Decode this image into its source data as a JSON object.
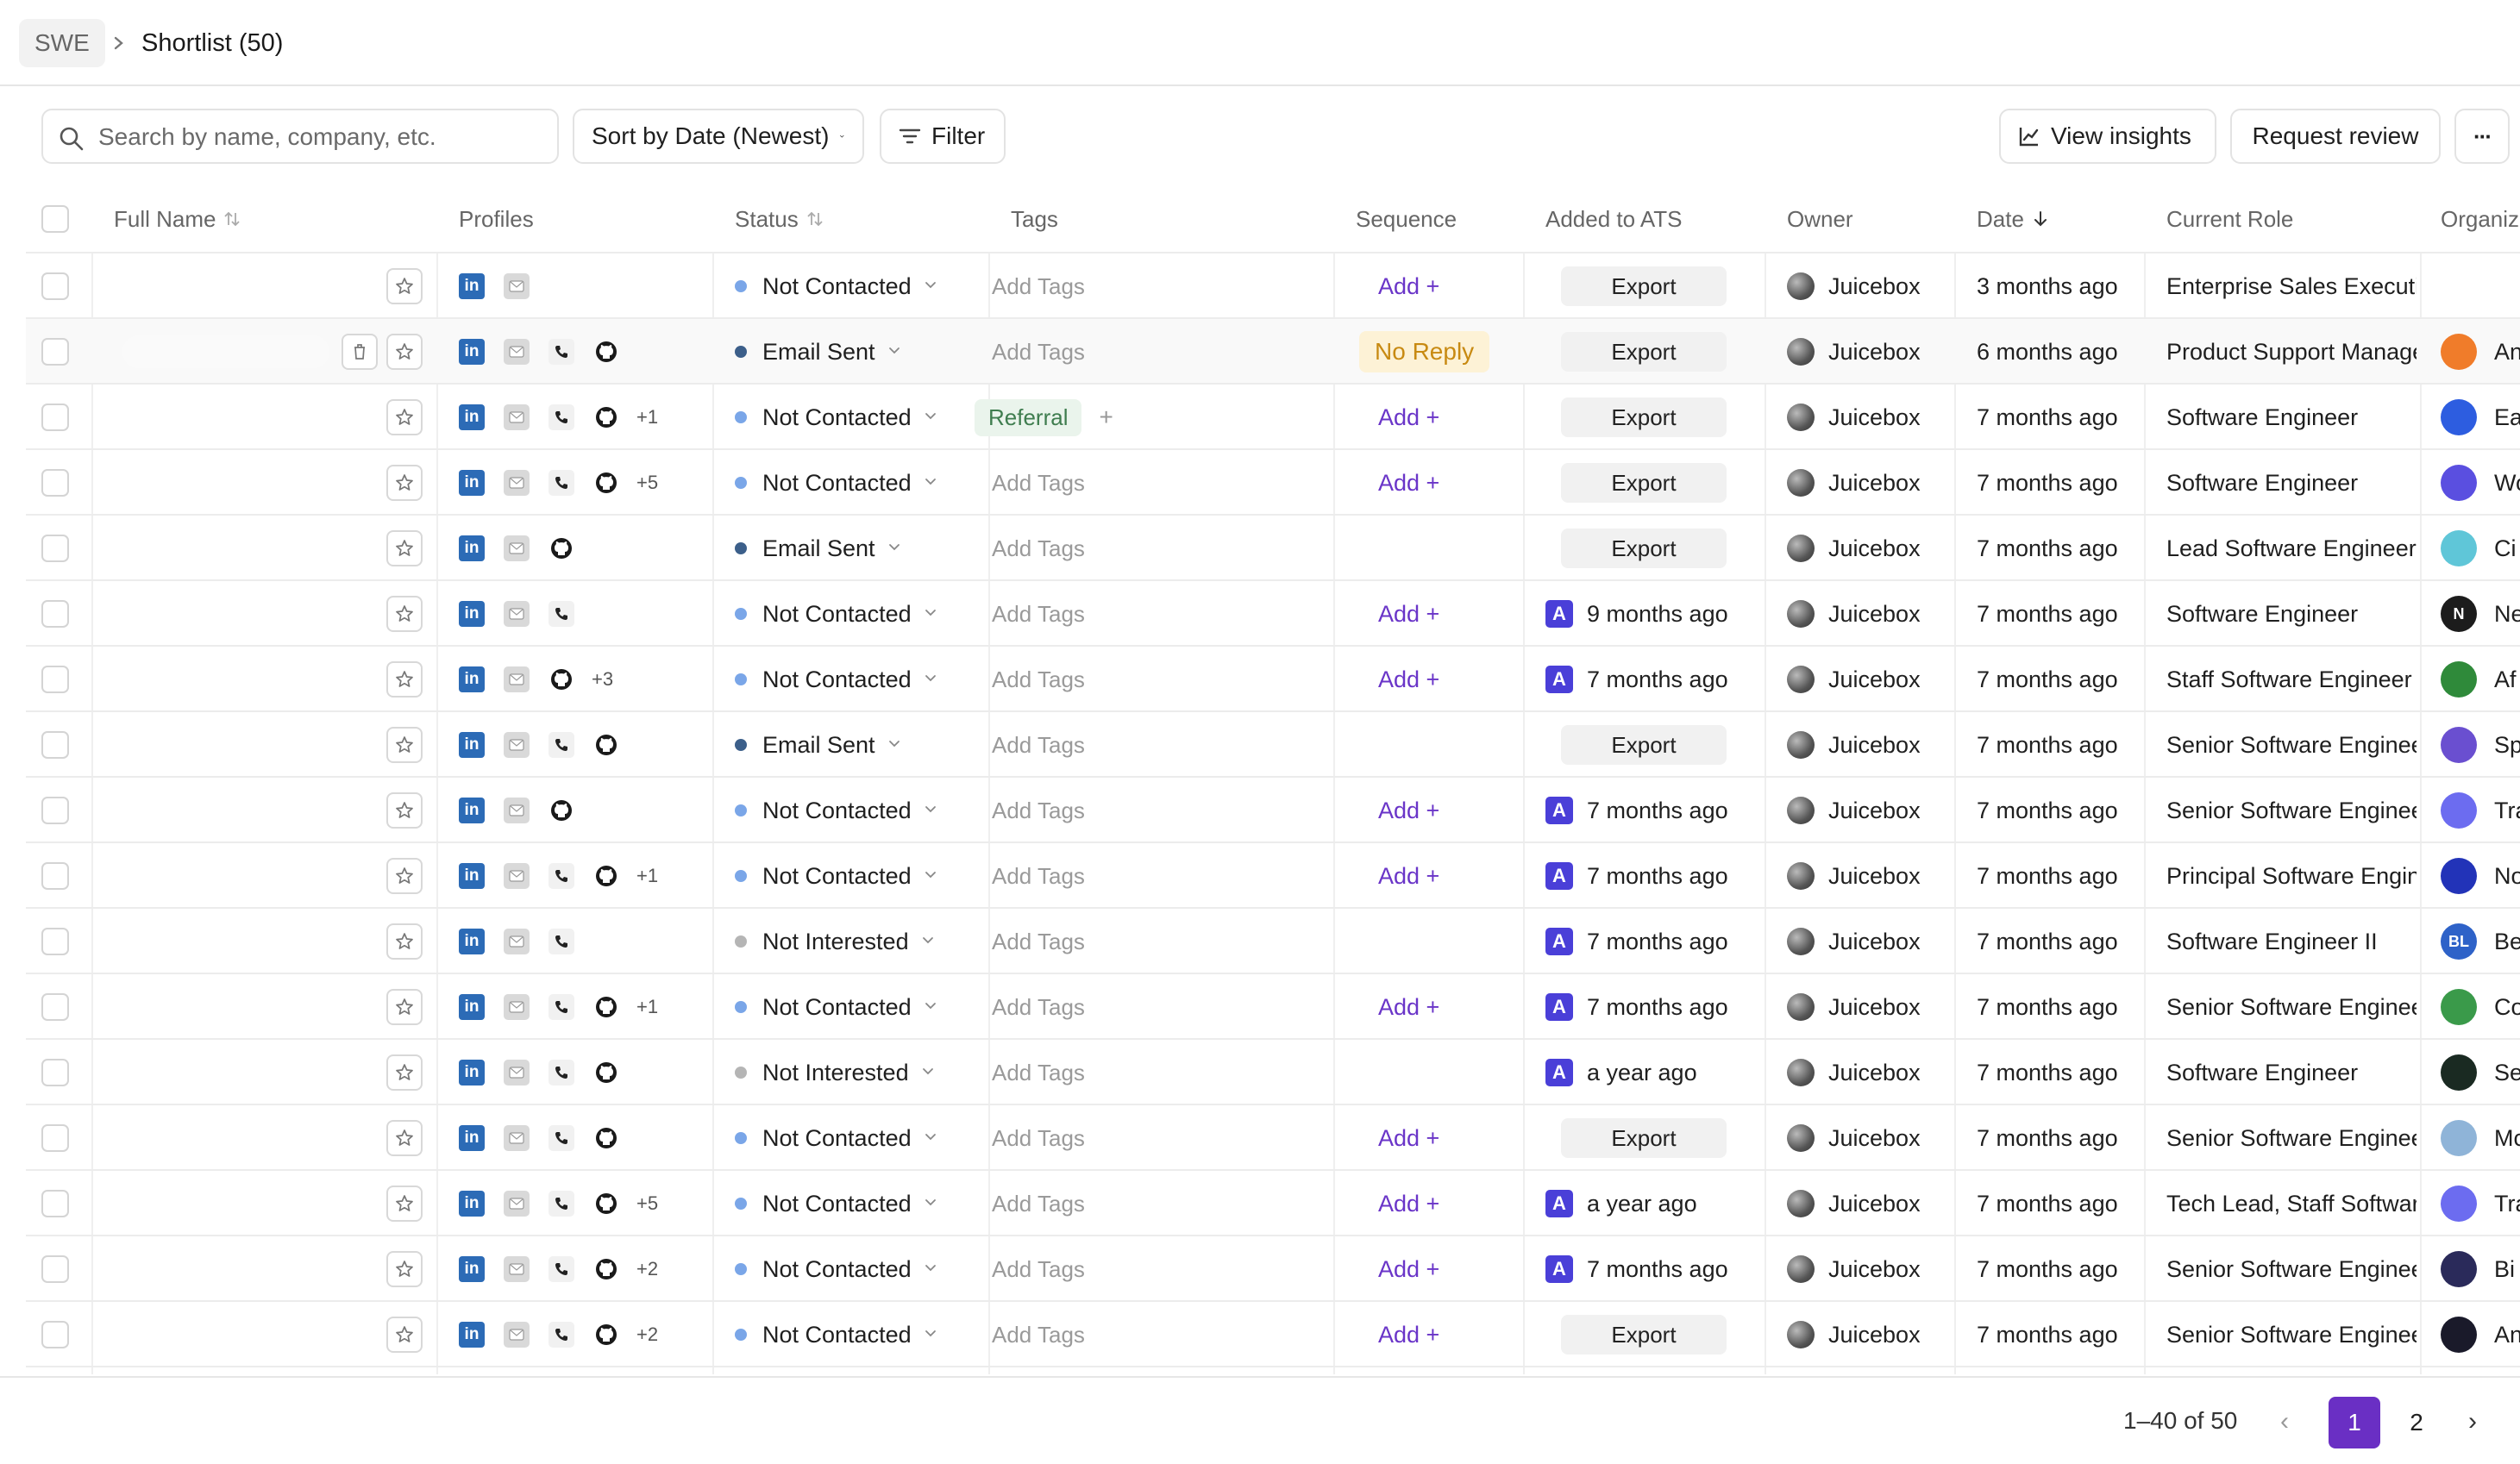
{
  "breadcrumb": {
    "root": "SWE",
    "current": "Shortlist (50)"
  },
  "toolbar": {
    "search_placeholder": "Search by name, company, etc.",
    "sort_label": "Sort by Date (Newest)",
    "filter_label": "Filter",
    "insights_label": "View insights",
    "review_label": "Request review",
    "more_label": "···"
  },
  "columns": {
    "full_name": "Full Name",
    "profiles": "Profiles",
    "status": "Status",
    "tags": "Tags",
    "sequence": "Sequence",
    "added_to_ats": "Added to ATS",
    "owner": "Owner",
    "date": "Date",
    "current_role": "Current Role",
    "organization": "Organiz"
  },
  "status_colors": {
    "Not Contacted": "#7aa6e8",
    "Email Sent": "#3c5f8a",
    "Not Interested": "#b5b5b5"
  },
  "rows": [
    {
      "profiles": [
        "linkedin",
        "email"
      ],
      "extra": "",
      "status": "Not Contacted",
      "tags": "Add Tags",
      "tag_chip": "",
      "sequence": "Add +",
      "sequence_type": "add",
      "ats": "Export",
      "ats_type": "export",
      "owner": "Juicebox",
      "date": "3 months ago",
      "role": "Enterprise Sales Executiv",
      "org": "",
      "org_color": "",
      "org_mark": ""
    },
    {
      "profiles": [
        "linkedin",
        "email",
        "phone",
        "github"
      ],
      "extra": "",
      "status": "Email Sent",
      "tags": "Add Tags",
      "tag_chip": "",
      "sequence": "No Reply",
      "sequence_type": "badge",
      "ats": "Export",
      "ats_type": "export",
      "owner": "Juicebox",
      "date": "6 months ago",
      "role": "Product Support Manage",
      "org": "An",
      "org_color": "#f07c2a",
      "org_mark": ""
    },
    {
      "profiles": [
        "linkedin",
        "email",
        "phone",
        "github"
      ],
      "extra": "+1",
      "status": "Not Contacted",
      "tags": "",
      "tag_chip": "Referral",
      "sequence": "Add +",
      "sequence_type": "add",
      "ats": "Export",
      "ats_type": "export",
      "owner": "Juicebox",
      "date": "7 months ago",
      "role": "Software Engineer",
      "org": "Ea",
      "org_color": "#2d5de0",
      "org_mark": ""
    },
    {
      "profiles": [
        "linkedin",
        "email",
        "phone",
        "github"
      ],
      "extra": "+5",
      "status": "Not Contacted",
      "tags": "Add Tags",
      "tag_chip": "",
      "sequence": "Add +",
      "sequence_type": "add",
      "ats": "Export",
      "ats_type": "export",
      "owner": "Juicebox",
      "date": "7 months ago",
      "role": "Software Engineer",
      "org": "Wo",
      "org_color": "#5a4fe0",
      "org_mark": ""
    },
    {
      "profiles": [
        "linkedin",
        "email",
        "github"
      ],
      "extra": "",
      "status": "Email Sent",
      "tags": "Add Tags",
      "tag_chip": "",
      "sequence": "",
      "sequence_type": "none",
      "ats": "Export",
      "ats_type": "export",
      "owner": "Juicebox",
      "date": "7 months ago",
      "role": "Lead Software Engineer",
      "org": "Ci",
      "org_color": "#5fc6d8",
      "org_mark": ""
    },
    {
      "profiles": [
        "linkedin",
        "email",
        "phone"
      ],
      "extra": "",
      "status": "Not Contacted",
      "tags": "Add Tags",
      "tag_chip": "",
      "sequence": "Add +",
      "sequence_type": "add",
      "ats": "9 months ago",
      "ats_type": "date",
      "owner": "Juicebox",
      "date": "7 months ago",
      "role": "Software Engineer",
      "org": "Ne",
      "org_color": "#1c1c1c",
      "org_mark": "N"
    },
    {
      "profiles": [
        "linkedin",
        "email",
        "github"
      ],
      "extra": "+3",
      "status": "Not Contacted",
      "tags": "Add Tags",
      "tag_chip": "",
      "sequence": "Add +",
      "sequence_type": "add",
      "ats": "7 months ago",
      "ats_type": "date",
      "owner": "Juicebox",
      "date": "7 months ago",
      "role": "Staff Software Engineer I",
      "org": "Af",
      "org_color": "#2f8a3a",
      "org_mark": ""
    },
    {
      "profiles": [
        "linkedin",
        "email",
        "phone",
        "github"
      ],
      "extra": "",
      "status": "Email Sent",
      "tags": "Add Tags",
      "tag_chip": "",
      "sequence": "",
      "sequence_type": "none",
      "ats": "Export",
      "ats_type": "export",
      "owner": "Juicebox",
      "date": "7 months ago",
      "role": "Senior Software Enginee",
      "org": "Sp",
      "org_color": "#6a4fd0",
      "org_mark": ""
    },
    {
      "profiles": [
        "linkedin",
        "email",
        "github"
      ],
      "extra": "",
      "status": "Not Contacted",
      "tags": "Add Tags",
      "tag_chip": "",
      "sequence": "Add +",
      "sequence_type": "add",
      "ats": "7 months ago",
      "ats_type": "date",
      "owner": "Juicebox",
      "date": "7 months ago",
      "role": "Senior Software Enginee",
      "org": "Tra",
      "org_color": "#6c6cf0",
      "org_mark": ""
    },
    {
      "profiles": [
        "linkedin",
        "email",
        "phone",
        "github"
      ],
      "extra": "+1",
      "status": "Not Contacted",
      "tags": "Add Tags",
      "tag_chip": "",
      "sequence": "Add +",
      "sequence_type": "add",
      "ats": "7 months ago",
      "ats_type": "date",
      "owner": "Juicebox",
      "date": "7 months ago",
      "role": "Principal Software Engin",
      "org": "No",
      "org_color": "#2233b8",
      "org_mark": ""
    },
    {
      "profiles": [
        "linkedin",
        "email",
        "phone"
      ],
      "extra": "",
      "status": "Not Interested",
      "tags": "Add Tags",
      "tag_chip": "",
      "sequence": "",
      "sequence_type": "none",
      "ats": "7 months ago",
      "ats_type": "date",
      "owner": "Juicebox",
      "date": "7 months ago",
      "role": "Software Engineer II",
      "org": "Be",
      "org_color": "#2e62c8",
      "org_mark": "BL"
    },
    {
      "profiles": [
        "linkedin",
        "email",
        "phone",
        "github"
      ],
      "extra": "+1",
      "status": "Not Contacted",
      "tags": "Add Tags",
      "tag_chip": "",
      "sequence": "Add +",
      "sequence_type": "add",
      "ats": "7 months ago",
      "ats_type": "date",
      "owner": "Juicebox",
      "date": "7 months ago",
      "role": "Senior Software Enginee",
      "org": "Co",
      "org_color": "#3a9a4a",
      "org_mark": ""
    },
    {
      "profiles": [
        "linkedin",
        "email",
        "phone",
        "github"
      ],
      "extra": "",
      "status": "Not Interested",
      "tags": "Add Tags",
      "tag_chip": "",
      "sequence": "",
      "sequence_type": "none",
      "ats": "a year ago",
      "ats_type": "date",
      "owner": "Juicebox",
      "date": "7 months ago",
      "role": "Software Engineer",
      "org": "Se",
      "org_color": "#1a2a22",
      "org_mark": ""
    },
    {
      "profiles": [
        "linkedin",
        "email",
        "phone",
        "github"
      ],
      "extra": "",
      "status": "Not Contacted",
      "tags": "Add Tags",
      "tag_chip": "",
      "sequence": "Add +",
      "sequence_type": "add",
      "ats": "Export",
      "ats_type": "export",
      "owner": "Juicebox",
      "date": "7 months ago",
      "role": "Senior Software Enginee",
      "org": "Mc",
      "org_color": "#8fb4d8",
      "org_mark": ""
    },
    {
      "profiles": [
        "linkedin",
        "email",
        "phone",
        "github"
      ],
      "extra": "+5",
      "status": "Not Contacted",
      "tags": "Add Tags",
      "tag_chip": "",
      "sequence": "Add +",
      "sequence_type": "add",
      "ats": "a year ago",
      "ats_type": "date",
      "owner": "Juicebox",
      "date": "7 months ago",
      "role": "Tech Lead, Staff Softwar",
      "org": "Tra",
      "org_color": "#6c6cf0",
      "org_mark": ""
    },
    {
      "profiles": [
        "linkedin",
        "email",
        "phone",
        "github"
      ],
      "extra": "+2",
      "status": "Not Contacted",
      "tags": "Add Tags",
      "tag_chip": "",
      "sequence": "Add +",
      "sequence_type": "add",
      "ats": "7 months ago",
      "ats_type": "date",
      "owner": "Juicebox",
      "date": "7 months ago",
      "role": "Senior Software Enginee",
      "org": "Bi",
      "org_color": "#2a2a5a",
      "org_mark": ""
    },
    {
      "profiles": [
        "linkedin",
        "email",
        "phone",
        "github"
      ],
      "extra": "+2",
      "status": "Not Contacted",
      "tags": "Add Tags",
      "tag_chip": "",
      "sequence": "Add +",
      "sequence_type": "add",
      "ats": "Export",
      "ats_type": "export",
      "owner": "Juicebox",
      "date": "7 months ago",
      "role": "Senior Software Enginee",
      "org": "An",
      "org_color": "#1a1a2a",
      "org_mark": ""
    }
  ],
  "pagination": {
    "range": "1–40 of 50",
    "page1": "1",
    "page2": "2",
    "prev": "‹",
    "next": "›"
  }
}
